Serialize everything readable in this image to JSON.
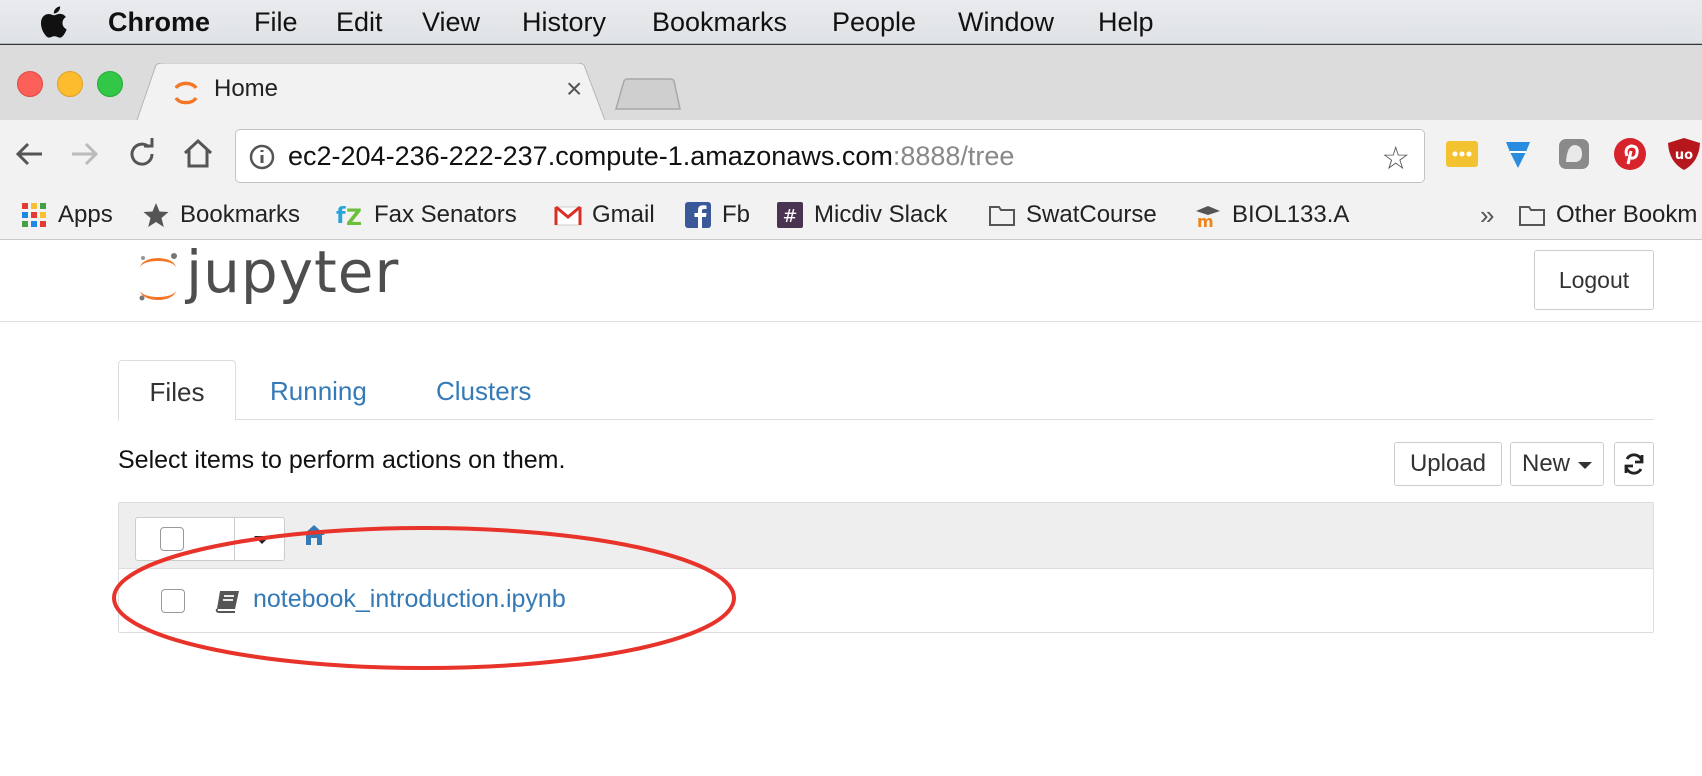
{
  "menubar": {
    "items": [
      "Chrome",
      "File",
      "Edit",
      "View",
      "History",
      "Bookmarks",
      "People",
      "Window",
      "Help"
    ]
  },
  "browser": {
    "tab": {
      "title": "Home",
      "close": "×"
    },
    "url": {
      "host": "ec2-204-236-222-237.compute-1.amazonaws.com",
      "path": ":8888/tree"
    }
  },
  "bookmarks": {
    "items": [
      "Apps",
      "Bookmarks",
      "Fax Senators",
      "Gmail",
      "Fb",
      "Micdiv Slack",
      "SwatCourse",
      "BIOL133.A"
    ],
    "overflow": "»",
    "other": "Other Bookm"
  },
  "jupyter": {
    "brand": "jupyter",
    "logout_label": "Logout",
    "tabs": [
      "Files",
      "Running",
      "Clusters"
    ],
    "hint": "Select items to perform actions on them.",
    "upload_label": "Upload",
    "new_label": "New",
    "files": [
      {
        "name": "notebook_introduction.ipynb",
        "icon": "notebook-icon"
      }
    ]
  },
  "colors": {
    "link": "#337ab7",
    "jupyter_orange": "#f37726",
    "annotation_red": "#e8332a"
  }
}
